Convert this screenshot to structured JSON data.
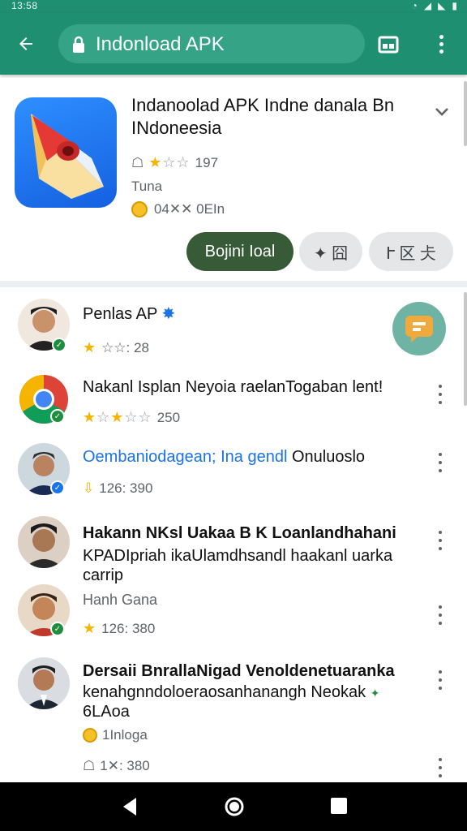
{
  "status_bar": {
    "time": "13:58"
  },
  "app_bar": {
    "url": "Indonload APK"
  },
  "app_header": {
    "title": "Indanoolad APK Indne danala Bn INdoneesia",
    "rating_count": "197",
    "line2": "Tuna",
    "line3": "04✕✕ 0EIn",
    "primary_button": "Bojini Ioal",
    "secondary_button_1": "✦ 囧",
    "secondary_button_2": "Ւ 区 仧"
  },
  "list": [
    {
      "title": "Penlas AP",
      "sub": "☆☆: 28",
      "badge_color": "#1e8e3e"
    },
    {
      "title": "Nakanl Isplan Neyoia raelanTogaban lent!",
      "sub": "250",
      "badge_color": "#1e8e3e"
    },
    {
      "title": "Oembaniodagean; Ina gendl",
      "title_suffix": "Onuluoslo",
      "sub": "126: 390",
      "badge_color": "#1a73e8"
    },
    {
      "title": "Hakann NKsl Uakaa B K Loanlandhahani",
      "title2": "KPADIpriah ikaUlamdhsandl haakanl uarka",
      "title3": "carrip",
      "badge_color": "#1e8e3e"
    },
    {
      "title": "Hanh Gana",
      "sub": "126: 380",
      "badge_color": "#1e8e3e"
    },
    {
      "title": "Dersaii BnrallaNigad Venoldenetuaranka",
      "title2": "kenahgnndoloeraosanhanangh Neokak",
      "title3": "6LAoa",
      "sub": "1Inloga"
    },
    {
      "sub": "1✕: 380"
    }
  ],
  "colors": {
    "header": "#1f8f72",
    "primary_button": "#375b37",
    "star": "#f4b400"
  }
}
